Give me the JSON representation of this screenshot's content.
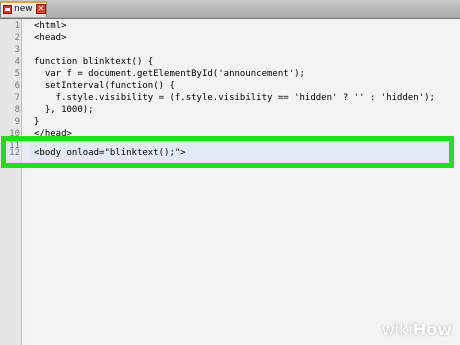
{
  "tab": {
    "label": "new 2",
    "close_glyph": "✕",
    "icon": "file-icon",
    "close_icon": "close-icon"
  },
  "editor": {
    "lines": [
      {
        "num": "1",
        "code": "<html>"
      },
      {
        "num": "2",
        "code": "<head>"
      },
      {
        "num": "3",
        "code": ""
      },
      {
        "num": "4",
        "code": "function blinktext() {"
      },
      {
        "num": "5",
        "code": "  var f = document.getElementById('announcement');"
      },
      {
        "num": "6",
        "code": "  setInterval(function() {"
      },
      {
        "num": "7",
        "code": "    f.style.visibility = (f.style.visibility == 'hidden' ? '' : 'hidden');"
      },
      {
        "num": "8",
        "code": "  }, 1000);"
      },
      {
        "num": "9",
        "code": "}"
      },
      {
        "num": "10",
        "code": "</head>"
      },
      {
        "num": "11",
        "code": ""
      },
      {
        "num": "12",
        "code": "<body onload=\"blinktext();\">"
      }
    ]
  },
  "watermark": {
    "wiki": "wiki",
    "how": "How"
  },
  "colors": {
    "highlight_border": "#1ee01e",
    "editor_background": "#7d7d7d",
    "code_background": "#f3f3f3"
  }
}
